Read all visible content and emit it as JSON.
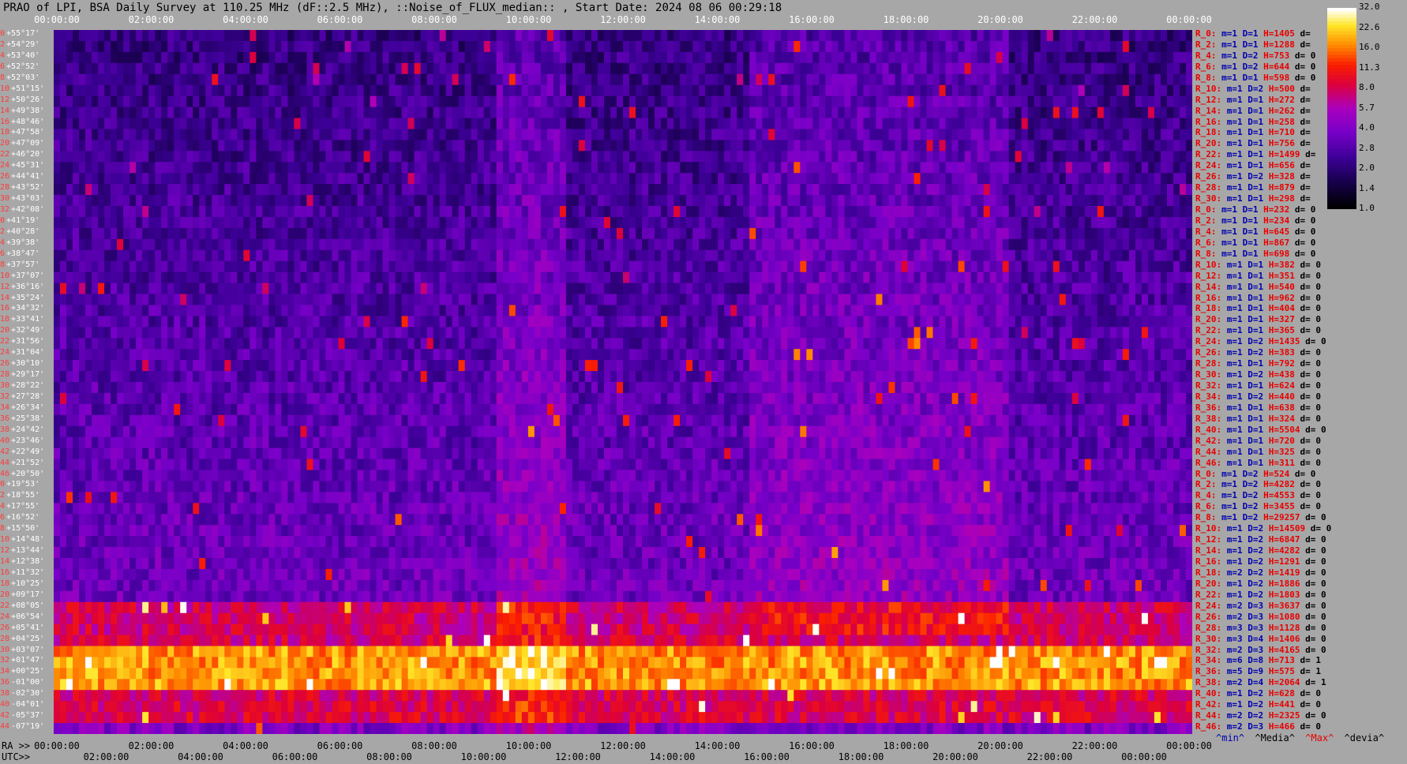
{
  "header": {
    "title": "PRAO of LPI, BSA Daily Survey at 110.25 MHz (dF::2.5 MHz), ::Noise_of_FLUX_median:: , Start Date: 2024 08 06 00:29:18"
  },
  "axes": {
    "top_ticks": [
      "00:00:00",
      "02:00:00",
      "04:00:00",
      "06:00:00",
      "08:00:00",
      "10:00:00",
      "12:00:00",
      "14:00:00",
      "16:00:00",
      "18:00:00",
      "20:00:00",
      "22:00:00",
      "00:00:00"
    ],
    "ra_prefix": "RA >>",
    "ra_ticks": [
      "00:00:00",
      "02:00:00",
      "04:00:00",
      "06:00:00",
      "08:00:00",
      "10:00:00",
      "12:00:00",
      "14:00:00",
      "16:00:00",
      "18:00:00",
      "20:00:00",
      "22:00:00",
      "00:00:00"
    ],
    "utc_prefix": "UTC>>",
    "utc_ticks": [
      "02:00:00",
      "04:00:00",
      "06:00:00",
      "08:00:00",
      "10:00:00",
      "12:00:00",
      "14:00:00",
      "16:00:00",
      "18:00:00",
      "20:00:00",
      "22:00:00",
      "00:00:00"
    ]
  },
  "colorbar": {
    "labels": [
      "32.0",
      "22.6",
      "16.0",
      "11.3",
      "8.0",
      "5.7",
      "4.0",
      "2.8",
      "2.0",
      "1.4",
      "1.0"
    ]
  },
  "legend": {
    "min": "^min^",
    "media": "^Media^",
    "max": "^Max^",
    "devia": "^devia^"
  },
  "chart_data": {
    "type": "heatmap",
    "title": "PRAO of LPI, BSA Daily Survey at 110.25 MHz (dF::2.5 MHz), ::Noise_of_FLUX_median:: , Start Date: 2024 08 06 00:29:18",
    "x_axis": "RA / UTC, 24 h",
    "colorbar_range": [
      1.0,
      32.0
    ],
    "declinations": [
      {
        "i": "0",
        "dec": "+55°17'"
      },
      {
        "i": "2",
        "dec": "+54°29'"
      },
      {
        "i": "4",
        "dec": "+53°40'"
      },
      {
        "i": "6",
        "dec": "+52°52'"
      },
      {
        "i": "8",
        "dec": "+52°03'"
      },
      {
        "i": "10",
        "dec": "+51°15'"
      },
      {
        "i": "12",
        "dec": "+50°26'"
      },
      {
        "i": "14",
        "dec": "+49°38'"
      },
      {
        "i": "16",
        "dec": "+48°46'"
      },
      {
        "i": "18",
        "dec": "+47°58'"
      },
      {
        "i": "20",
        "dec": "+47°09'"
      },
      {
        "i": "22",
        "dec": "+46°20'"
      },
      {
        "i": "24",
        "dec": "+45°31'"
      },
      {
        "i": "26",
        "dec": "+44°41'"
      },
      {
        "i": "28",
        "dec": "+43°52'"
      },
      {
        "i": "30",
        "dec": "+43°03'"
      },
      {
        "i": "32",
        "dec": "+42°08'"
      },
      {
        "i": "0",
        "dec": "+41°19'"
      },
      {
        "i": "2",
        "dec": "+40°28'"
      },
      {
        "i": "4",
        "dec": "+39°38'"
      },
      {
        "i": "6",
        "dec": "+38°47'"
      },
      {
        "i": "8",
        "dec": "+37°57'"
      },
      {
        "i": "10",
        "dec": "+37°07'"
      },
      {
        "i": "12",
        "dec": "+36°16'"
      },
      {
        "i": "14",
        "dec": "+35°24'"
      },
      {
        "i": "16",
        "dec": "+34°32'"
      },
      {
        "i": "18",
        "dec": "+33°41'"
      },
      {
        "i": "20",
        "dec": "+32°49'"
      },
      {
        "i": "22",
        "dec": "+31°56'"
      },
      {
        "i": "24",
        "dec": "+31°04'"
      },
      {
        "i": "26",
        "dec": "+30°10'"
      },
      {
        "i": "28",
        "dec": "+29°17'"
      },
      {
        "i": "30",
        "dec": "+28°22'"
      },
      {
        "i": "32",
        "dec": "+27°28'"
      },
      {
        "i": "34",
        "dec": "+26°34'"
      },
      {
        "i": "36",
        "dec": "+25°38'"
      },
      {
        "i": "38",
        "dec": "+24°42'"
      },
      {
        "i": "40",
        "dec": "+23°46'"
      },
      {
        "i": "42",
        "dec": "+22°49'"
      },
      {
        "i": "44",
        "dec": "+21°52'"
      },
      {
        "i": "46",
        "dec": "+20°50'"
      },
      {
        "i": "0",
        "dec": "+19°53'"
      },
      {
        "i": "2",
        "dec": "+18°55'"
      },
      {
        "i": "4",
        "dec": "+17°55'"
      },
      {
        "i": "6",
        "dec": "+16°52'"
      },
      {
        "i": "8",
        "dec": "+15°50'"
      },
      {
        "i": "10",
        "dec": "+14°48'"
      },
      {
        "i": "12",
        "dec": "+13°44'"
      },
      {
        "i": "14",
        "dec": "+12°38'"
      },
      {
        "i": "16",
        "dec": "+11°32'"
      },
      {
        "i": "18",
        "dec": "+10°25'"
      },
      {
        "i": "20",
        "dec": "+09°17'"
      },
      {
        "i": "22",
        "dec": "+08°05'"
      },
      {
        "i": "24",
        "dec": "+06°54'"
      },
      {
        "i": "26",
        "dec": "+05°41'"
      },
      {
        "i": "28",
        "dec": "+04°25'"
      },
      {
        "i": "30",
        "dec": "+03°07'"
      },
      {
        "i": "32",
        "dec": "+01°47'"
      },
      {
        "i": "34",
        "dec": "+00°25'"
      },
      {
        "i": "36",
        "dec": "-01°00'"
      },
      {
        "i": "38",
        "dec": "-02°30'"
      },
      {
        "i": "40",
        "dec": "-04°01'"
      },
      {
        "i": "42",
        "dec": "-05°37'"
      },
      {
        "i": "44",
        "dec": "-07°19'"
      }
    ],
    "stats": [
      {
        "r": "R_0:",
        "m": "m=1",
        "d": "D=1",
        "h": "H=1405",
        "dv": "d="
      },
      {
        "r": "R_2:",
        "m": "m=1",
        "d": "D=1",
        "h": "H=1288",
        "dv": "d="
      },
      {
        "r": "R_4:",
        "m": "m=1",
        "d": "D=2",
        "h": "H=753",
        "dv": "d= 0"
      },
      {
        "r": "R_6:",
        "m": "m=1",
        "d": "D=2",
        "h": "H=644",
        "dv": "d= 0"
      },
      {
        "r": "R_8:",
        "m": "m=1",
        "d": "D=1",
        "h": "H=598",
        "dv": "d= 0"
      },
      {
        "r": "R_10:",
        "m": "m=1",
        "d": "D=2",
        "h": "H=500",
        "dv": "d="
      },
      {
        "r": "R_12:",
        "m": "m=1",
        "d": "D=1",
        "h": "H=272",
        "dv": "d="
      },
      {
        "r": "R_14:",
        "m": "m=1",
        "d": "D=1",
        "h": "H=262",
        "dv": "d="
      },
      {
        "r": "R_16:",
        "m": "m=1",
        "d": "D=1",
        "h": "H=258",
        "dv": "d="
      },
      {
        "r": "R_18:",
        "m": "m=1",
        "d": "D=1",
        "h": "H=710",
        "dv": "d="
      },
      {
        "r": "R_20:",
        "m": "m=1",
        "d": "D=1",
        "h": "H=756",
        "dv": "d="
      },
      {
        "r": "R_22:",
        "m": "m=1",
        "d": "D=1",
        "h": "H=1499",
        "dv": "d="
      },
      {
        "r": "R_24:",
        "m": "m=1",
        "d": "D=1",
        "h": "H=656",
        "dv": "d="
      },
      {
        "r": "R_26:",
        "m": "m=1",
        "d": "D=2",
        "h": "H=328",
        "dv": "d="
      },
      {
        "r": "R_28:",
        "m": "m=1",
        "d": "D=1",
        "h": "H=879",
        "dv": "d="
      },
      {
        "r": "R_30:",
        "m": "m=1",
        "d": "D=1",
        "h": "H=298",
        "dv": "d="
      },
      {
        "r": "R_0:",
        "m": "m=1",
        "d": "D=1",
        "h": "H=232",
        "dv": "d= 0"
      },
      {
        "r": "R_2:",
        "m": "m=1",
        "d": "D=1",
        "h": "H=234",
        "dv": "d= 0"
      },
      {
        "r": "R_4:",
        "m": "m=1",
        "d": "D=1",
        "h": "H=645",
        "dv": "d= 0"
      },
      {
        "r": "R_6:",
        "m": "m=1",
        "d": "D=1",
        "h": "H=867",
        "dv": "d= 0"
      },
      {
        "r": "R_8:",
        "m": "m=1",
        "d": "D=1",
        "h": "H=698",
        "dv": "d= 0"
      },
      {
        "r": "R_10:",
        "m": "m=1",
        "d": "D=1",
        "h": "H=382",
        "dv": "d= 0"
      },
      {
        "r": "R_12:",
        "m": "m=1",
        "d": "D=1",
        "h": "H=351",
        "dv": "d= 0"
      },
      {
        "r": "R_14:",
        "m": "m=1",
        "d": "D=1",
        "h": "H=540",
        "dv": "d= 0"
      },
      {
        "r": "R_16:",
        "m": "m=1",
        "d": "D=1",
        "h": "H=962",
        "dv": "d= 0"
      },
      {
        "r": "R_18:",
        "m": "m=1",
        "d": "D=1",
        "h": "H=404",
        "dv": "d= 0"
      },
      {
        "r": "R_20:",
        "m": "m=1",
        "d": "D=1",
        "h": "H=327",
        "dv": "d= 0"
      },
      {
        "r": "R_22:",
        "m": "m=1",
        "d": "D=1",
        "h": "H=365",
        "dv": "d= 0"
      },
      {
        "r": "R_24:",
        "m": "m=1",
        "d": "D=2",
        "h": "H=1435",
        "dv": "d= 0"
      },
      {
        "r": "R_26:",
        "m": "m=1",
        "d": "D=2",
        "h": "H=383",
        "dv": "d= 0"
      },
      {
        "r": "R_28:",
        "m": "m=1",
        "d": "D=1",
        "h": "H=792",
        "dv": "d= 0"
      },
      {
        "r": "R_30:",
        "m": "m=1",
        "d": "D=2",
        "h": "H=438",
        "dv": "d= 0"
      },
      {
        "r": "R_32:",
        "m": "m=1",
        "d": "D=1",
        "h": "H=624",
        "dv": "d= 0"
      },
      {
        "r": "R_34:",
        "m": "m=1",
        "d": "D=2",
        "h": "H=440",
        "dv": "d= 0"
      },
      {
        "r": "R_36:",
        "m": "m=1",
        "d": "D=1",
        "h": "H=638",
        "dv": "d= 0"
      },
      {
        "r": "R_38:",
        "m": "m=1",
        "d": "D=1",
        "h": "H=324",
        "dv": "d= 0"
      },
      {
        "r": "R_40:",
        "m": "m=1",
        "d": "D=1",
        "h": "H=5504",
        "dv": "d= 0"
      },
      {
        "r": "R_42:",
        "m": "m=1",
        "d": "D=1",
        "h": "H=720",
        "dv": "d= 0"
      },
      {
        "r": "R_44:",
        "m": "m=1",
        "d": "D=1",
        "h": "H=325",
        "dv": "d= 0"
      },
      {
        "r": "R_46:",
        "m": "m=1",
        "d": "D=1",
        "h": "H=311",
        "dv": "d= 0"
      },
      {
        "r": "R_0:",
        "m": "m=1",
        "d": "D=2",
        "h": "H=524",
        "dv": "d= 0"
      },
      {
        "r": "R_2:",
        "m": "m=1",
        "d": "D=2",
        "h": "H=4282",
        "dv": "d= 0"
      },
      {
        "r": "R_4:",
        "m": "m=1",
        "d": "D=2",
        "h": "H=4553",
        "dv": "d= 0"
      },
      {
        "r": "R_6:",
        "m": "m=1",
        "d": "D=2",
        "h": "H=3455",
        "dv": "d= 0"
      },
      {
        "r": "R_8:",
        "m": "m=1",
        "d": "D=2",
        "h": "H=29257",
        "dv": "d= 0"
      },
      {
        "r": "R_10:",
        "m": "m=1",
        "d": "D=2",
        "h": "H=14509",
        "dv": "d= 0"
      },
      {
        "r": "R_12:",
        "m": "m=1",
        "d": "D=2",
        "h": "H=6847",
        "dv": "d= 0"
      },
      {
        "r": "R_14:",
        "m": "m=1",
        "d": "D=2",
        "h": "H=4282",
        "dv": "d= 0"
      },
      {
        "r": "R_16:",
        "m": "m=1",
        "d": "D=2",
        "h": "H=1291",
        "dv": "d= 0"
      },
      {
        "r": "R_18:",
        "m": "m=2",
        "d": "D=2",
        "h": "H=1419",
        "dv": "d= 0"
      },
      {
        "r": "R_20:",
        "m": "m=1",
        "d": "D=2",
        "h": "H=1886",
        "dv": "d= 0"
      },
      {
        "r": "R_22:",
        "m": "m=1",
        "d": "D=2",
        "h": "H=1803",
        "dv": "d= 0"
      },
      {
        "r": "R_24:",
        "m": "m=2",
        "d": "D=3",
        "h": "H=3637",
        "dv": "d= 0"
      },
      {
        "r": "R_26:",
        "m": "m=2",
        "d": "D=3",
        "h": "H=1080",
        "dv": "d= 0"
      },
      {
        "r": "R_28:",
        "m": "m=3",
        "d": "D=3",
        "h": "H=1128",
        "dv": "d= 0"
      },
      {
        "r": "R_30:",
        "m": "m=3",
        "d": "D=4",
        "h": "H=1406",
        "dv": "d= 0"
      },
      {
        "r": "R_32:",
        "m": "m=2",
        "d": "D=3",
        "h": "H=4165",
        "dv": "d= 0"
      },
      {
        "r": "R_34:",
        "m": "m=6",
        "d": "D=8",
        "h": "H=713",
        "dv": "d= 1"
      },
      {
        "r": "R_36:",
        "m": "m=5",
        "d": "D=9",
        "h": "H=575",
        "dv": "d= 1"
      },
      {
        "r": "R_38:",
        "m": "m=2",
        "d": "D=4",
        "h": "H=2064",
        "dv": "d= 1"
      },
      {
        "r": "R_40:",
        "m": "m=1",
        "d": "D=2",
        "h": "H=628",
        "dv": "d= 0"
      },
      {
        "r": "R_42:",
        "m": "m=1",
        "d": "D=2",
        "h": "H=441",
        "dv": "d= 0"
      },
      {
        "r": "R_44:",
        "m": "m=2",
        "d": "D=2",
        "h": "H=2325",
        "dv": "d= 0"
      },
      {
        "r": "R_46:",
        "m": "m=2",
        "d": "D=3",
        "h": "H=466",
        "dv": "d= 0"
      }
    ]
  }
}
